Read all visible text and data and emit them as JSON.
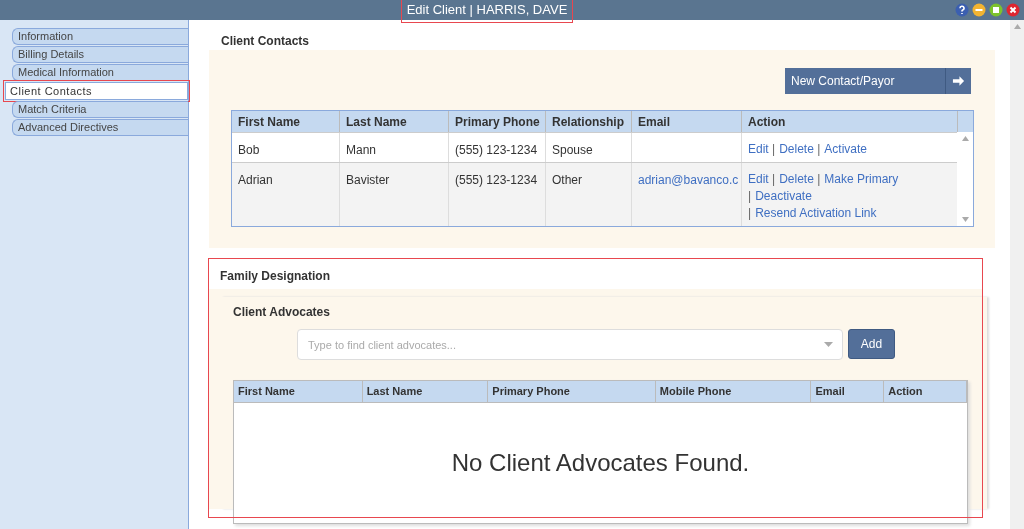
{
  "window": {
    "title": "Edit Client | HARRIS, DAVE",
    "title_highlighted": true
  },
  "sidebar": {
    "items": [
      {
        "label": "Information",
        "selected": false,
        "highlighted": false
      },
      {
        "label": "Billing Details",
        "selected": false,
        "highlighted": false
      },
      {
        "label": "Medical Information",
        "selected": false,
        "highlighted": false
      },
      {
        "label": "Client Contacts",
        "selected": true,
        "highlighted": true
      },
      {
        "label": "Match Criteria",
        "selected": false,
        "highlighted": false
      },
      {
        "label": "Advanced Directives",
        "selected": false,
        "highlighted": false
      }
    ]
  },
  "client_contacts": {
    "heading": "Client Contacts",
    "new_button": "New Contact/Payor",
    "columns": [
      "First Name",
      "Last Name",
      "Primary Phone",
      "Relationship",
      "Email",
      "Action"
    ],
    "action_separator": "|",
    "rows": [
      {
        "cells": [
          "Bob",
          "Mann",
          "(555) 123-1234",
          "Spouse",
          ""
        ],
        "actions": [
          "Edit",
          "Delete",
          "Activate"
        ]
      },
      {
        "cells": [
          "Adrian",
          "Bavister",
          "(555) 123-1234",
          "Other",
          "adrian@bavanco.c"
        ],
        "actions": [
          "Edit",
          "Delete",
          "Make Primary",
          "Deactivate",
          "Resend Activation Link"
        ]
      }
    ]
  },
  "family_designation": {
    "heading": "Family Designation",
    "highlighted": true,
    "client_advocates": {
      "heading": "Client Advocates",
      "search": {
        "placeholder": "Type to find client advocates..."
      },
      "add_button": "Add",
      "columns": [
        "First Name",
        "Last Name",
        "Primary Phone",
        "Mobile Phone",
        "Email",
        "Action"
      ],
      "empty_message": "No Client Advocates Found."
    }
  }
}
